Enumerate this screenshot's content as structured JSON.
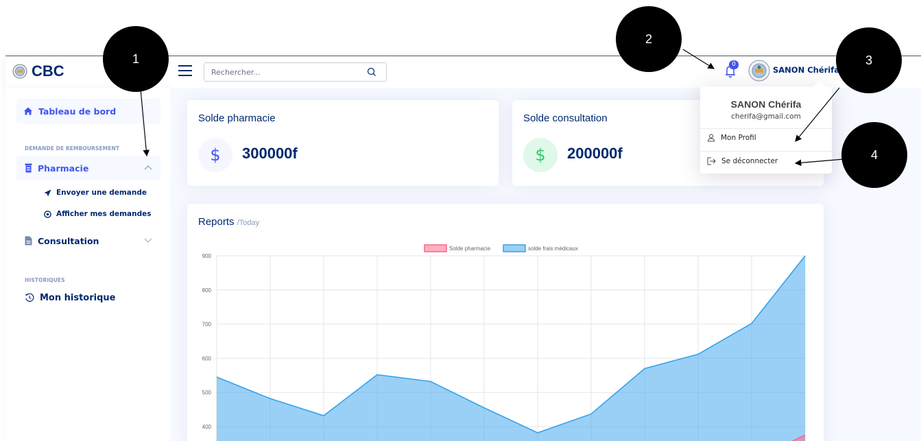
{
  "app": {
    "logo_text": "CBC"
  },
  "header": {
    "search_placeholder": "Rechercher...",
    "notification_count": "0",
    "user_label": "SANON Chérifa"
  },
  "sidebar": {
    "dashboard": "Tableau de bord",
    "section_refund": "DEMANDE DE REMBOURSEMENT",
    "pharmacy": "Pharmacie",
    "send_request": "Envoyer une demande",
    "show_requests": "Afficher mes demandes",
    "consultation": "Consultation",
    "section_history": "HISTORIQUES",
    "my_history": "Mon historique"
  },
  "cards": {
    "pharmacy": {
      "title": "Solde pharmacie",
      "value": "300000f",
      "symbol": "$"
    },
    "consultation": {
      "title": "Solde consultation",
      "value": "200000f",
      "symbol": "$"
    }
  },
  "dropdown": {
    "name": "SANON Chérifa",
    "email": "cherifa@gmail.com",
    "profile": "Mon Profil",
    "logout": "Se déconnecter"
  },
  "reports": {
    "title": "Reports",
    "subtitle": "/Today"
  },
  "markers": [
    "1",
    "2",
    "3",
    "4"
  ],
  "colors": {
    "primary": "#4154f1",
    "navy": "#012970",
    "pharmacy_series": "#ff6384",
    "medical_series": "#36a2eb"
  },
  "chart_data": {
    "type": "area",
    "x": [
      1,
      2,
      3,
      4,
      5,
      6,
      7,
      8,
      9,
      10,
      11,
      12
    ],
    "ylim": [
      350,
      900
    ],
    "yticks": [
      400,
      500,
      600,
      700,
      800,
      900
    ],
    "ytick_labels": [
      "400",
      "500",
      "600",
      "700",
      "800",
      "900"
    ],
    "legend_position": "top-center",
    "grid": true,
    "series": [
      {
        "name": "Solde pharmacie",
        "color": "#ff6384",
        "points": [
          [
            12,
            375
          ]
        ]
      },
      {
        "name": "solde frais médicaux",
        "color": "#36a2eb",
        "values": [
          545,
          482,
          432,
          552,
          532,
          455,
          382,
          437,
          570,
          612,
          702,
          900
        ]
      }
    ]
  }
}
